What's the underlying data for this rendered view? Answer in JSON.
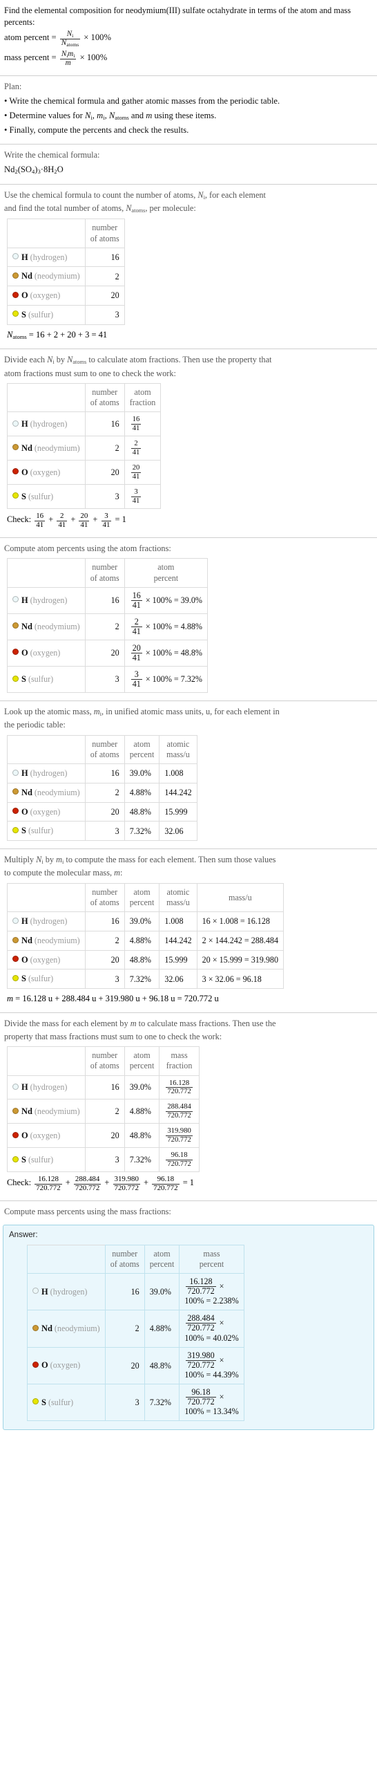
{
  "header": {
    "question": "Find the elemental composition for neodymium(III) sulfate octahydrate in terms of the atom and mass percents:",
    "atom_percent_label": "atom percent",
    "mass_percent_label": "mass percent",
    "eq_num_Ni": "N",
    "eq_num_Ni_sub": "i",
    "eq_den_atoms": "N",
    "eq_den_atoms_sub": "atoms",
    "eq_den_m": "m",
    "times_100": "× 100%"
  },
  "plan": {
    "title": "Plan:",
    "bullets": [
      "• Write the chemical formula and gather atomic masses from the periodic table.",
      "• Determine values for Ni, mi, Natoms and m using these items.",
      "• Finally, compute the percents and check the results."
    ]
  },
  "formula_section": {
    "prompt": "Write the chemical formula:",
    "formula": "Nd2(SO4)3·8H2O"
  },
  "count_section": {
    "prompt_line1": "Use the chemical formula to count the number of atoms, Ni, for each element",
    "prompt_line2": "and find the total number of atoms, Natoms, per molecule:",
    "header_number_of_atoms_l1": "number",
    "header_number_of_atoms_l2": "of atoms",
    "total_line": "Natoms = 16 + 2 + 20 + 3 = 41"
  },
  "fraction_section": {
    "prompt_line1": "Divide each Ni by Natoms to calculate atom fractions. Then use the property that",
    "prompt_line2": "atom fractions must sum to one to check the work:",
    "header_atom_fraction_l1": "atom",
    "header_atom_fraction_l2": "fraction",
    "check_label": "Check:",
    "check_equals": "= 1"
  },
  "atom_percent_section": {
    "prompt": "Compute atom percents using the atom fractions:",
    "header_atom_percent_l1": "atom",
    "header_atom_percent_l2": "percent"
  },
  "atomic_mass_section": {
    "prompt_line1": "Look up the atomic mass, mi, in unified atomic mass units, u, for each element in",
    "prompt_line2": "the periodic table:",
    "header_atomic_mass_l1": "atomic",
    "header_atomic_mass_l2": "mass/u"
  },
  "mass_section": {
    "prompt_line1": "Multiply Ni by mi to compute the mass for each element. Then sum those values",
    "prompt_line2": "to compute the molecular mass, m:",
    "header_mass": "mass/u",
    "total_line": "m = 16.128 u + 288.484 u + 319.980 u + 96.18 u = 720.772 u"
  },
  "mass_fraction_section": {
    "prompt_line1": "Divide the mass for each element by m to calculate mass fractions. Then use the",
    "prompt_line2": "property that mass fractions must sum to one to check the work:",
    "header_mass_fraction_l1": "mass",
    "header_mass_fraction_l2": "fraction",
    "check_label": "Check:",
    "check_equals": "= 1"
  },
  "mass_percent_section": {
    "prompt": "Compute mass percents using the mass fractions:",
    "answer_label": "Answer:",
    "header_mass_percent_l1": "mass",
    "header_mass_percent_l2": "percent"
  },
  "colors": {
    "hydrogen": "#ecf7f8",
    "neodymium": "#cc9933",
    "oxygen": "#cc2200",
    "sulfur": "#e6e600",
    "answer_bg": "#eaf7fc",
    "answer_border": "#9fd4e4",
    "table_border": "#dcdcdc"
  },
  "denominator_atoms": "41",
  "molecular_mass": "720.772",
  "elements": [
    {
      "symbol": "H",
      "name": "(hydrogen)",
      "color_key": "hydrogen",
      "atoms": "16",
      "fraction_num": "16",
      "fraction_den": "41",
      "atom_percent": "39.0%",
      "atom_percent_value": "39.0%",
      "atomic_mass": "1.008",
      "mass_expr": "16 × 1.008 = 16.128",
      "mass": "16.128",
      "mass_percent_value": "2.238%"
    },
    {
      "symbol": "Nd",
      "name": "(neodymium)",
      "color_key": "neodymium",
      "atoms": "2",
      "fraction_num": "2",
      "fraction_den": "41",
      "atom_percent": "4.88%",
      "atom_percent_value": "4.88%",
      "atomic_mass": "144.242",
      "mass_expr": "2 × 144.242 = 288.484",
      "mass": "288.484",
      "mass_percent_value": "40.02%"
    },
    {
      "symbol": "O",
      "name": "(oxygen)",
      "color_key": "oxygen",
      "atoms": "20",
      "fraction_num": "20",
      "fraction_den": "41",
      "atom_percent": "48.8%",
      "atom_percent_value": "48.8%",
      "atomic_mass": "15.999",
      "mass_expr": "20 × 15.999 = 319.980",
      "mass": "319.980",
      "mass_percent_value": "44.39%"
    },
    {
      "symbol": "S",
      "name": "(sulfur)",
      "color_key": "sulfur",
      "atoms": "3",
      "fraction_num": "3",
      "fraction_den": "41",
      "atom_percent": "7.32%",
      "atom_percent_value": "7.32%",
      "atomic_mass": "32.06",
      "mass_expr": "3 × 32.06 = 96.18",
      "mass": "96.18",
      "mass_percent_value": "13.34%"
    }
  ]
}
